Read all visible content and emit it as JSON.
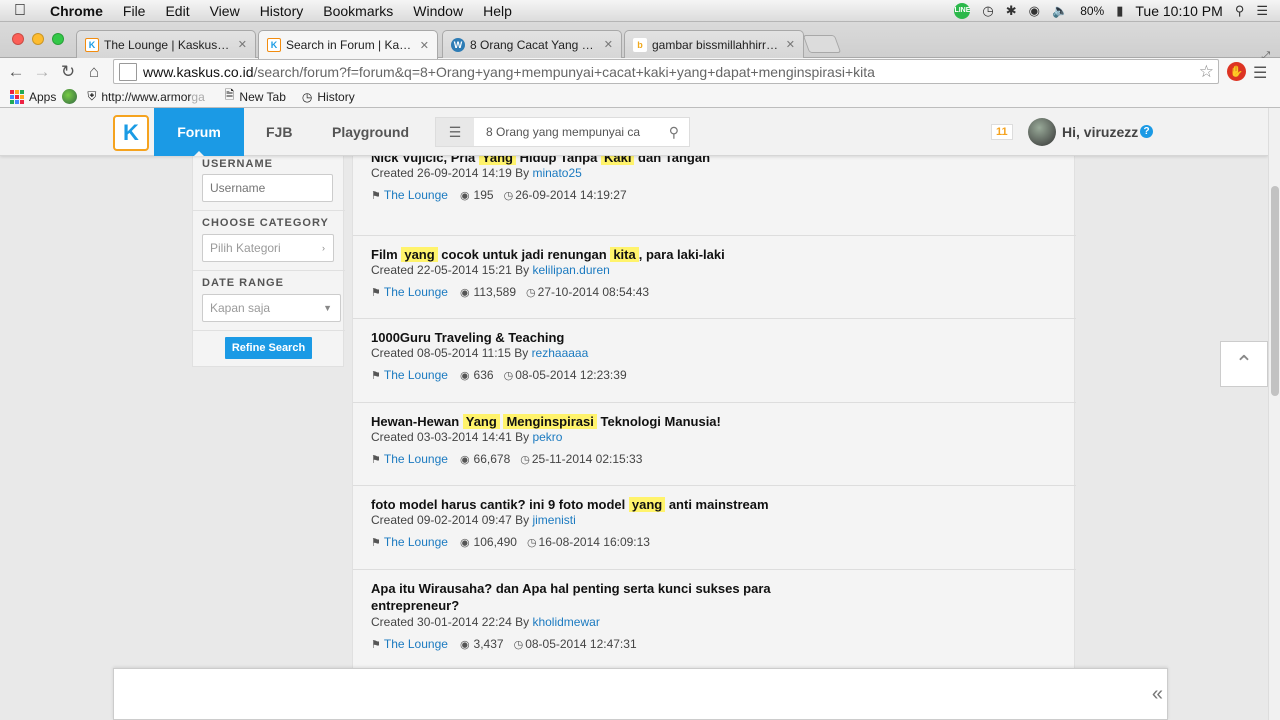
{
  "menubar": {
    "app": "Chrome",
    "items": [
      "File",
      "Edit",
      "View",
      "History",
      "Bookmarks",
      "Window",
      "Help"
    ],
    "battery": "80%",
    "clock": "Tue 10:10 PM"
  },
  "tabs": [
    {
      "title": "The Lounge | Kaskus – The",
      "favicon": "kaskus-icon"
    },
    {
      "title": "Search in Forum | Kaskus –",
      "favicon": "kaskus-icon"
    },
    {
      "title": "8 Orang Cacat Yang Mengi",
      "favicon": "wordpress-icon"
    },
    {
      "title": "gambar bissmillahhirrohm",
      "favicon": "bing-icon"
    }
  ],
  "address": {
    "domain": "www.kaskus.co.id",
    "path": "/search/forum?f=forum&q=8+Orang+yang+mempunyai+cacat+kaki+yang+dapat+menginspirasi+kita"
  },
  "bookmarks": {
    "apps": "Apps",
    "armor_a": "http://www.armor",
    "armor_b": "ga",
    "newtab": "New Tab",
    "history": "History"
  },
  "kaskus": {
    "nav": {
      "forum": "Forum",
      "fjb": "FJB",
      "playground": "Playground"
    },
    "search_value": "8 Orang yang mempunyai ca",
    "notif_count": "11",
    "greeting": "Hi, viruzezz",
    "help": "?"
  },
  "filter": {
    "username_label": "USERNAME",
    "username_placeholder": "Username",
    "category_label": "CHOOSE CATEGORY",
    "category_value": "Pilih Kategori",
    "date_label": "DATE RANGE",
    "date_value": "Kapan saja",
    "button": "Refine Search"
  },
  "results": [
    {
      "title_parts": [
        {
          "t": "Nick Vujicic, Pria ",
          "hl": false
        },
        {
          "t": "Yang",
          "hl": true
        },
        {
          "t": " Hidup Tanpa ",
          "hl": false
        },
        {
          "t": "Kaki",
          "hl": true
        },
        {
          "t": " dan Tangan",
          "hl": false
        }
      ],
      "created": "Created 26-09-2014 14:19 By",
      "author": "minato25",
      "forum": "The Lounge",
      "views": "195",
      "last": "26-09-2014 14:19:27"
    },
    {
      "title_parts": [
        {
          "t": "Film ",
          "hl": false
        },
        {
          "t": "yang",
          "hl": true
        },
        {
          "t": " cocok untuk jadi renungan ",
          "hl": false
        },
        {
          "t": "kita",
          "hl": true
        },
        {
          "t": ", para laki-laki",
          "hl": false
        }
      ],
      "created": "Created 22-05-2014 15:21 By",
      "author": "kelilipan.duren",
      "forum": "The Lounge",
      "views": "113,589",
      "last": "27-10-2014 08:54:43"
    },
    {
      "title_parts": [
        {
          "t": "1000Guru Traveling & Teaching",
          "hl": false
        }
      ],
      "created": "Created 08-05-2014 11:15 By",
      "author": "rezhaaaaa",
      "forum": "The Lounge",
      "views": "636",
      "last": "08-05-2014 12:23:39"
    },
    {
      "title_parts": [
        {
          "t": "Hewan-Hewan ",
          "hl": false
        },
        {
          "t": "Yang",
          "hl": true
        },
        {
          "t": " ",
          "hl": false
        },
        {
          "t": "Menginspirasi",
          "hl": true
        },
        {
          "t": " Teknologi Manusia!",
          "hl": false
        }
      ],
      "created": "Created 03-03-2014 14:41 By",
      "author": "pekro",
      "forum": "The Lounge",
      "views": "66,678",
      "last": "25-11-2014 02:15:33"
    },
    {
      "title_parts": [
        {
          "t": "foto model harus cantik? ini 9 foto model ",
          "hl": false
        },
        {
          "t": "yang",
          "hl": true
        },
        {
          "t": " anti mainstream",
          "hl": false
        }
      ],
      "created": "Created 09-02-2014 09:47 By",
      "author": "jimenisti",
      "forum": "The Lounge",
      "views": "106,490",
      "last": "16-08-2014 16:09:13"
    },
    {
      "title_parts": [
        {
          "t": "Apa itu Wirausaha? dan Apa hal penting serta kunci sukses para entrepreneur?",
          "hl": false
        }
      ],
      "created": "Created 30-01-2014 22:24 By",
      "author": "kholidmewar",
      "forum": "The Lounge",
      "views": "3,437",
      "last": "08-05-2014 12:47:31"
    }
  ],
  "colors": {
    "kaskus_blue": "#1b9ae5",
    "kaskus_orange": "#f5a31f",
    "highlight": "#fff36b",
    "link": "#1b7ac0"
  }
}
